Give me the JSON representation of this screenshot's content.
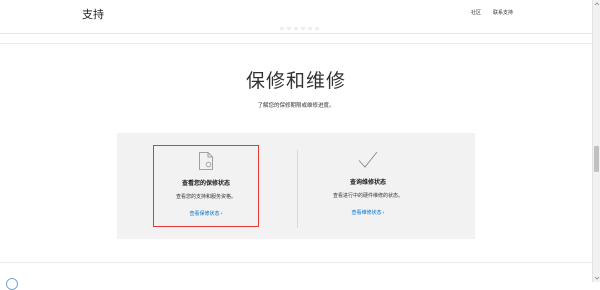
{
  "header": {
    "brand": "支持",
    "links": [
      "社区",
      "联系支持"
    ]
  },
  "hero": {
    "title": "保修和维修",
    "subtitle": "了解您的保修期限或维修进度。"
  },
  "cards": [
    {
      "icon": "document-icon",
      "title": "查看您的保修状态",
      "description": "查看您的支持和服务资格。",
      "link": "查看保修状态",
      "link_chevron": "›"
    },
    {
      "icon": "checkmark-icon",
      "title": "查询维修状态",
      "description": "查看进行中的硬件维修的状态。",
      "link": "查看维修状态",
      "link_chevron": "›"
    }
  ],
  "colors": {
    "accent_link": "#0070c9",
    "highlight_border": "#e53935",
    "panel_bg": "#f2f2f2"
  }
}
